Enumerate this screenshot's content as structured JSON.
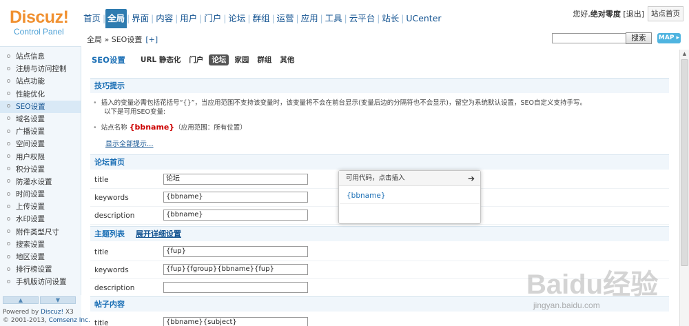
{
  "logo": {
    "main": "Discuz!",
    "sub": "Control Panel"
  },
  "topnav": [
    {
      "label": "首页",
      "active": false
    },
    {
      "label": "全局",
      "active": true
    },
    {
      "label": "界面",
      "active": false
    },
    {
      "label": "内容",
      "active": false
    },
    {
      "label": "用户",
      "active": false
    },
    {
      "label": "门户",
      "active": false
    },
    {
      "label": "论坛",
      "active": false
    },
    {
      "label": "群组",
      "active": false
    },
    {
      "label": "运营",
      "active": false
    },
    {
      "label": "应用",
      "active": false
    },
    {
      "label": "工具",
      "active": false
    },
    {
      "label": "云平台",
      "active": false
    },
    {
      "label": "站长",
      "active": false
    },
    {
      "label": "UCenter",
      "active": false
    }
  ],
  "user": {
    "greeting": "您好,",
    "name": "绝对零度",
    "logout": "[退出]",
    "site_home": "站点首页"
  },
  "breadcrumb": {
    "text": "全局 » SEO设置",
    "plus": "[+]"
  },
  "search": {
    "button": "搜索",
    "map": "MAP ▸"
  },
  "sidebar": {
    "items": [
      {
        "label": "站点信息",
        "active": false
      },
      {
        "label": "注册与访问控制",
        "active": false
      },
      {
        "label": "站点功能",
        "active": false
      },
      {
        "label": "性能优化",
        "active": false
      },
      {
        "label": "SEO设置",
        "active": true
      },
      {
        "label": "域名设置",
        "active": false
      },
      {
        "label": "广播设置",
        "active": false
      },
      {
        "label": "空间设置",
        "active": false
      },
      {
        "label": "用户权限",
        "active": false
      },
      {
        "label": "积分设置",
        "active": false
      },
      {
        "label": "防灌水设置",
        "active": false
      },
      {
        "label": "时间设置",
        "active": false
      },
      {
        "label": "上传设置",
        "active": false
      },
      {
        "label": "水印设置",
        "active": false
      },
      {
        "label": "附件类型尺寸",
        "active": false
      },
      {
        "label": "搜索设置",
        "active": false
      },
      {
        "label": "地区设置",
        "active": false
      },
      {
        "label": "排行榜设置",
        "active": false
      },
      {
        "label": "手机版访问设置",
        "active": false
      }
    ],
    "powered_prefix": "Powered by ",
    "powered_link": "Discuz!",
    "powered_ver": " X3",
    "copyright_prefix": "© 2001-2013, ",
    "copyright_link": "Comsenz Inc."
  },
  "tabs": {
    "title": "SEO设置",
    "items": [
      {
        "label": "URL 静态化",
        "active": false
      },
      {
        "label": "门户",
        "active": false
      },
      {
        "label": "论坛",
        "active": true
      },
      {
        "label": "家园",
        "active": false
      },
      {
        "label": "群组",
        "active": false
      },
      {
        "label": "其他",
        "active": false
      }
    ]
  },
  "tips": {
    "header": "技巧提示",
    "line1": "插入的变量必需包括花括号“{}”，当应用范围不支持该变量时，该变量将不会在前台显示(变量后边的分隔符也不会显示)，留空为系统默认设置，SEO自定义支持手写。",
    "line2": "以下是可用SEO变量:",
    "site_name_prefix": "站点名称 ",
    "site_name_var": "{bbname}",
    "site_name_suffix": "（应用范围：所有位置）",
    "show_all": "显示全部提示..."
  },
  "forum_index": {
    "header": "论坛首页",
    "rows": [
      {
        "label": "title",
        "value": "论坛"
      },
      {
        "label": "keywords",
        "value": "{bbname}"
      },
      {
        "label": "description",
        "value": "{bbname}"
      }
    ]
  },
  "thread_list": {
    "header": "主题列表",
    "expand": "展开详细设置",
    "rows": [
      {
        "label": "title",
        "value": "{fup}"
      },
      {
        "label": "keywords",
        "value": "{fup}{fgroup}{bbname}{fup}"
      },
      {
        "label": "description",
        "value": ""
      }
    ]
  },
  "post_content": {
    "header": "帖子内容",
    "rows": [
      {
        "label": "title",
        "value": "{bbname}{subject}"
      }
    ]
  },
  "popup": {
    "title": "可用代码，点击插入",
    "arrow": "➔",
    "code": "{bbname}"
  },
  "watermark": {
    "main": "Baidu经验",
    "sub": "jingyan.baidu.com"
  },
  "colors": {
    "accent": "#2f7cb0",
    "link": "#135391",
    "section_bg": "#f0f6fb",
    "variable": "#cc0000"
  }
}
